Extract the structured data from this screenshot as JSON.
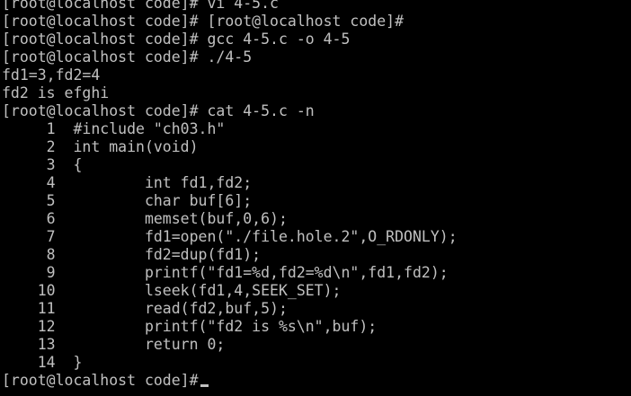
{
  "terminal": {
    "lines": [
      "[root@localhost code]# vi 4-5.c",
      "[root@localhost code]# [root@localhost code]#",
      "[root@localhost code]# gcc 4-5.c -o 4-5",
      "[root@localhost code]# ./4-5",
      "fd1=3,fd2=4",
      "fd2 is efghi",
      "[root@localhost code]# cat 4-5.c -n",
      "     1  #include \"ch03.h\"",
      "     2  int main(void)",
      "     3  {",
      "     4          int fd1,fd2;",
      "     5          char buf[6];",
      "     6          memset(buf,0,6);",
      "     7          fd1=open(\"./file.hole.2\",O_RDONLY);",
      "     8          fd2=dup(fd1);",
      "     9          printf(\"fd1=%d,fd2=%d\\n\",fd1,fd2);",
      "    10          lseek(fd1,4,SEEK_SET);",
      "    11          read(fd2,buf,5);",
      "    12          printf(\"fd2 is %s\\n\",buf);",
      "    13          return 0;",
      "    14  }",
      "[root@localhost code]#"
    ],
    "colors": {
      "background": "#000000",
      "foreground": "#c0c0c0"
    }
  }
}
